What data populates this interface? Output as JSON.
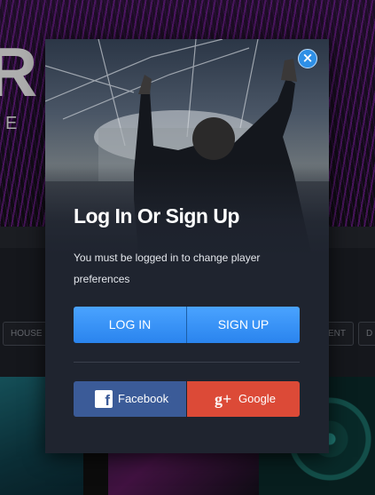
{
  "background": {
    "logo_letter": "R",
    "tagline": "E P",
    "genre_chips": [
      "HOUSE",
      "ENT",
      "D"
    ]
  },
  "modal": {
    "close_glyph": "×",
    "title": "Log In Or Sign Up",
    "message": "You must be logged in to change player preferences",
    "login_label": "LOG IN",
    "signup_label": "SIGN UP",
    "facebook_label": "Facebook",
    "google_label": "Google",
    "facebook_glyph": "f",
    "google_glyph": "g+",
    "icons": [
      "close-icon",
      "facebook-icon",
      "google-plus-icon"
    ]
  },
  "colors": {
    "accent_blue": "#2a84ee",
    "facebook_blue": "#3b5b98",
    "google_red": "#dc4a37",
    "modal_bg": "#1f242f"
  }
}
